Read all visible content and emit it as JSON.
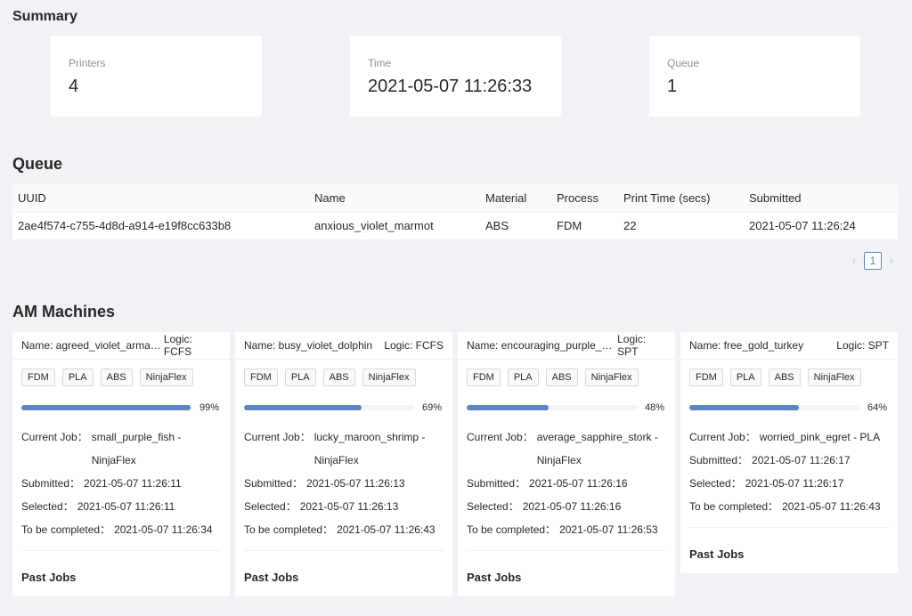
{
  "summary": {
    "title": "Summary",
    "cards": [
      {
        "label": "Printers",
        "value": "4"
      },
      {
        "label": "Time",
        "value": "2021-05-07 11:26:33"
      },
      {
        "label": "Queue",
        "value": "1"
      }
    ]
  },
  "queue": {
    "title": "Queue",
    "columns": [
      "UUID",
      "Name",
      "Material",
      "Process",
      "Print Time (secs)",
      "Submitted"
    ],
    "rows": [
      [
        "2ae4f574-c755-4d8d-a914-e19f8cc633b8",
        "anxious_violet_marmot",
        "ABS",
        "FDM",
        "22",
        "2021-05-07 11:26:24"
      ]
    ],
    "pagination": {
      "current": "1",
      "prev": "‹",
      "next": "›"
    }
  },
  "machines": {
    "title": "AM Machines",
    "items": [
      {
        "name": "Name: agreed_violet_armadillo",
        "logic": "Logic: FCFS",
        "tags": [
          "FDM",
          "PLA",
          "ABS",
          "NinjaFlex"
        ],
        "progress": 0.99,
        "progress_label": "99%",
        "current_job_label": "Current Job：",
        "current_job": "small_purple_fish - NinjaFlex",
        "submitted_label": "Submitted：",
        "submitted": "2021-05-07 11:26:11",
        "selected_label": "Selected：",
        "selected": "2021-05-07 11:26:11",
        "complete_label": "To be completed：",
        "complete": "2021-05-07 11:26:34",
        "past_jobs": "Past Jobs"
      },
      {
        "name": "Name: busy_violet_dolphin",
        "logic": "Logic: FCFS",
        "tags": [
          "FDM",
          "PLA",
          "ABS",
          "NinjaFlex"
        ],
        "progress": 0.69,
        "progress_label": "69%",
        "current_job_label": "Current Job：",
        "current_job": "lucky_maroon_shrimp - NinjaFlex",
        "submitted_label": "Submitted：",
        "submitted": "2021-05-07 11:26:13",
        "selected_label": "Selected：",
        "selected": "2021-05-07 11:26:13",
        "complete_label": "To be completed：",
        "complete": "2021-05-07 11:26:43",
        "past_jobs": "Past Jobs"
      },
      {
        "name": "Name: encouraging_purple_plat...",
        "logic": "Logic: SPT",
        "tags": [
          "FDM",
          "PLA",
          "ABS",
          "NinjaFlex"
        ],
        "progress": 0.48,
        "progress_label": "48%",
        "current_job_label": "Current Job：",
        "current_job": "average_sapphire_stork - NinjaFlex",
        "submitted_label": "Submitted：",
        "submitted": "2021-05-07 11:26:16",
        "selected_label": "Selected：",
        "selected": "2021-05-07 11:26:16",
        "complete_label": "To be completed：",
        "complete": "2021-05-07 11:26:53",
        "past_jobs": "Past Jobs"
      },
      {
        "name": "Name: free_gold_turkey",
        "logic": "Logic: SPT",
        "tags": [
          "FDM",
          "PLA",
          "ABS",
          "NinjaFlex"
        ],
        "progress": 0.64,
        "progress_label": "64%",
        "current_job_label": "Current Job：",
        "current_job": "worried_pink_egret - PLA",
        "submitted_label": "Submitted：",
        "submitted": "2021-05-07 11:26:17",
        "selected_label": "Selected：",
        "selected": "2021-05-07 11:26:17",
        "complete_label": "To be completed：",
        "complete": "2021-05-07 11:26:43",
        "past_jobs": "Past Jobs"
      }
    ]
  },
  "colors": {
    "accent": "#5b85c6",
    "background": "#f0f2f5"
  }
}
